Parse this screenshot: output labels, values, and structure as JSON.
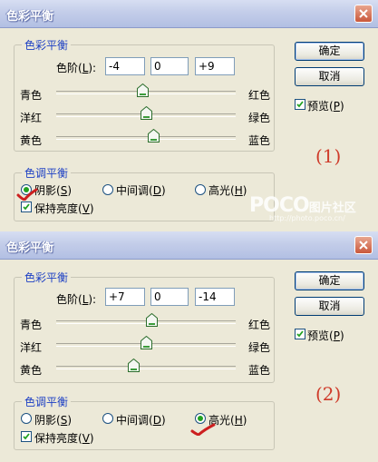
{
  "dialogs": [
    {
      "title": "色彩平衡",
      "group_balance": "色彩平衡",
      "levels_label": "色阶(",
      "levels_key": "L",
      "levels_end": "):",
      "levels": [
        "-4",
        "0",
        "+9"
      ],
      "sliders": [
        {
          "left": "青色",
          "right": "红色",
          "value": -4
        },
        {
          "left": "洋红",
          "right": "绿色",
          "value": 0
        },
        {
          "left": "黄色",
          "right": "蓝色",
          "value": 9
        }
      ],
      "group_tone": "色调平衡",
      "tones": [
        {
          "label": "阴影(",
          "key": "S",
          "end": ")",
          "checked": true
        },
        {
          "label": "中间调(",
          "key": "D",
          "end": ")",
          "checked": false
        },
        {
          "label": "高光(",
          "key": "H",
          "end": ")",
          "checked": false
        }
      ],
      "preserve_label": "保持亮度(",
      "preserve_key": "V",
      "preserve_end": ")",
      "preserve_checked": true,
      "ok_label": "确定",
      "cancel_label": "取消",
      "preview_label": "预览(",
      "preview_key": "P",
      "preview_end": ")",
      "preview_checked": true,
      "step_label": "(1)"
    },
    {
      "title": "色彩平衡",
      "group_balance": "色彩平衡",
      "levels_label": "色阶(",
      "levels_key": "L",
      "levels_end": "):",
      "levels": [
        "+7",
        "0",
        "-14"
      ],
      "sliders": [
        {
          "left": "青色",
          "right": "红色",
          "value": 7
        },
        {
          "left": "洋红",
          "right": "绿色",
          "value": 0
        },
        {
          "left": "黄色",
          "right": "蓝色",
          "value": -14
        }
      ],
      "group_tone": "色调平衡",
      "tones": [
        {
          "label": "阴影(",
          "key": "S",
          "end": ")",
          "checked": false
        },
        {
          "label": "中间调(",
          "key": "D",
          "end": ")",
          "checked": false
        },
        {
          "label": "高光(",
          "key": "H",
          "end": ")",
          "checked": true
        }
      ],
      "preserve_label": "保持亮度(",
      "preserve_key": "V",
      "preserve_end": ")",
      "preserve_checked": true,
      "ok_label": "确定",
      "cancel_label": "取消",
      "preview_label": "预览(",
      "preview_key": "P",
      "preview_end": ")",
      "preview_checked": true,
      "step_label": "(2)"
    }
  ],
  "watermark": {
    "brand": "POCO",
    "brand_cn": "图片社区",
    "url": "http://photo.poco.cn/"
  },
  "colors": {
    "accent": "#1c3fc4",
    "step": "#cf3b2a",
    "checkmark": "#cc1f1f"
  }
}
